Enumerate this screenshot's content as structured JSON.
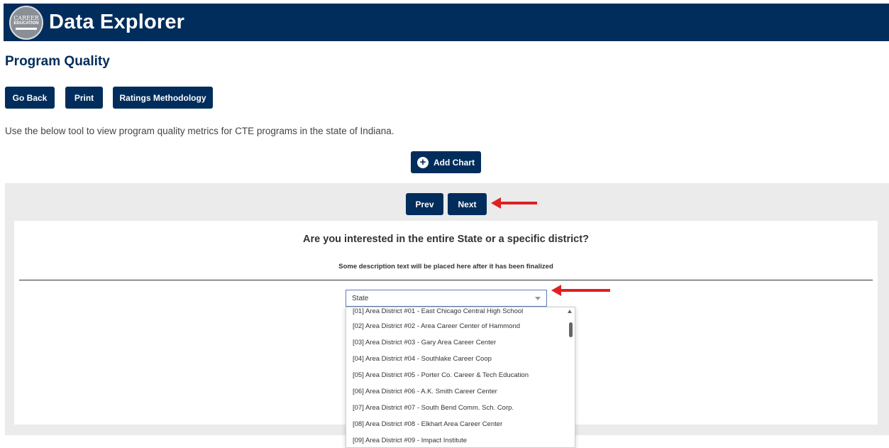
{
  "header": {
    "logo": {
      "line1": "CAREER",
      "line2": "EDUCATION",
      "icon": "gear-globe-icon"
    },
    "title": "Data Explorer"
  },
  "page": {
    "title": "Program Quality",
    "description": "Use the below tool to view program quality metrics for CTE programs in the state of Indiana."
  },
  "toolbar": {
    "go_back": "Go Back",
    "print": "Print",
    "ratings": "Ratings Methodology",
    "add_chart": "Add Chart"
  },
  "wizard": {
    "prev": "Prev",
    "next": "Next",
    "question": "Are you interested in the entire State or a specific district?",
    "subdescription": "Some description text will be placed here after it has been finalized",
    "select_value": "State",
    "options": [
      "[01] Area District #01 - East Chicago Central High School",
      "[02] Area District #02 - Area Career Center of Hammond",
      "[03] Area District #03 - Gary Area Career Center",
      "[04] Area District #04 - Southlake Career Coop",
      "[05] Area District #05 - Porter Co. Career & Tech Education",
      "[06] Area District #06 - A.K. Smith Career Center",
      "[07] Area District #07 - South Bend Comm. Sch. Corp.",
      "[08] Area District #08 - Elkhart Area Career Center",
      "[09] Area District #09 - Impact Institute"
    ]
  },
  "colors": {
    "brand": "#002d5c",
    "annotation": "#e02020"
  }
}
